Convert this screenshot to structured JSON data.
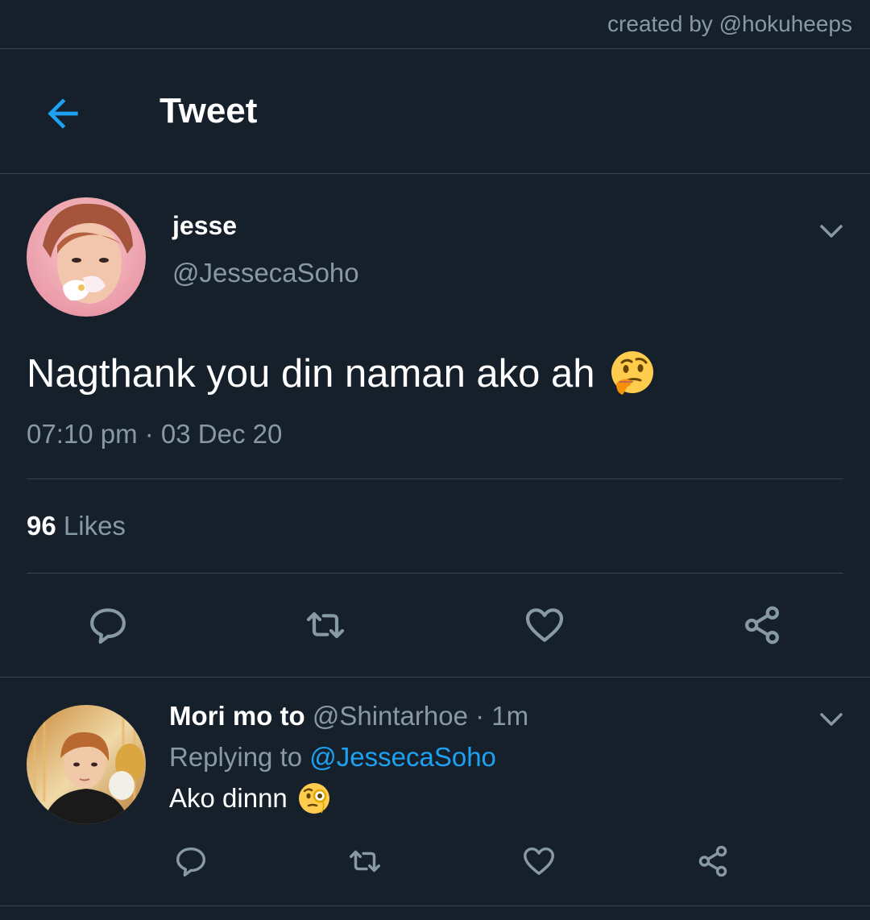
{
  "credit": {
    "text": "created by @hokuheeps"
  },
  "header": {
    "title": "Tweet",
    "back_icon": "arrow-left-icon"
  },
  "tweet": {
    "display_name": "jesse",
    "handle": "@JessecaSoho",
    "text": "Nagthank you din naman ako ah",
    "emoji": "thinking-face",
    "meta": "07:10 pm · 03 Dec 20",
    "likes_count": "96",
    "likes_label": "Likes",
    "actions": [
      "reply-icon",
      "retweet-icon",
      "like-icon",
      "share-icon"
    ]
  },
  "reply": {
    "display_name": "Mori mo to",
    "handle": "@Shintarhoe",
    "separator": "·",
    "time": "1m",
    "replying_prefix": "Replying to",
    "replying_to": "@JessecaSoho",
    "text": "Ako dinnn",
    "emoji": "face-with-monocle",
    "actions": [
      "reply-icon",
      "retweet-icon",
      "like-icon",
      "share-icon"
    ]
  },
  "colors": {
    "background": "#15202b",
    "divider": "#38444d",
    "primary_text": "#ffffff",
    "secondary_text": "#8899a6",
    "accent": "#1da1f2"
  }
}
